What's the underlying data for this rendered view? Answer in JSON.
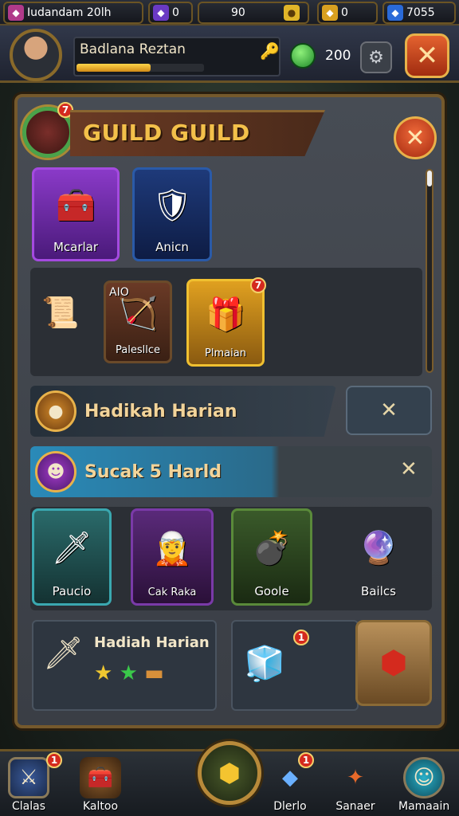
{
  "topbar": {
    "title": "Iudandam 20lh",
    "gem_count": "0",
    "stat_mid": "90",
    "coins": "0",
    "crystals": "7055"
  },
  "player": {
    "name": "Badlana Reztan",
    "xp_progress": 0.58,
    "gems": "200"
  },
  "panel": {
    "title": "GUILD GUILD",
    "badge": "7",
    "row1": [
      {
        "label": "Mcarlar",
        "icon": "treasure-chest-icon"
      },
      {
        "label": "Anicn",
        "icon": "shield-icon"
      }
    ],
    "row2": [
      {
        "label": "",
        "icon": "scroll-icon"
      },
      {
        "label": "Palesllce",
        "top_label": "AIO",
        "icon": "crossbow-icon"
      },
      {
        "label": "Plmaian",
        "icon": "chest-icon",
        "badge": "7"
      }
    ],
    "banner1": {
      "label": "Hadikah Harian"
    },
    "banner2": {
      "label": "Sucak 5 Harld"
    },
    "row3": [
      {
        "label": "Paucio",
        "icon": "sword-icon"
      },
      {
        "label": "Cak Raka",
        "icon": "hero-portrait-icon"
      },
      {
        "label": "Goole",
        "icon": "cannon-icon"
      },
      {
        "label": "Bailcs",
        "icon": "orb-icon"
      }
    ],
    "reward": {
      "label": "Hadiah Harian",
      "badge": "1"
    }
  },
  "nav": [
    {
      "label": "Clalas",
      "badge": "1"
    },
    {
      "label": "Kaltoo"
    },
    {
      "label": "Dlerlo",
      "badge": "1"
    },
    {
      "label": "Sanaer"
    },
    {
      "label": "Mamaain"
    }
  ]
}
